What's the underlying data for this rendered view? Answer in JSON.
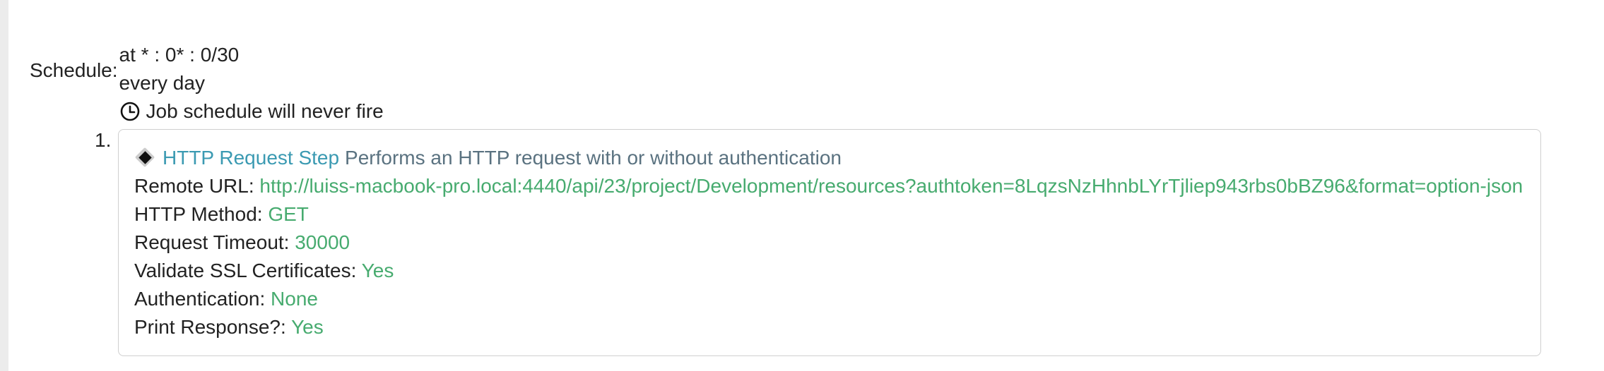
{
  "schedule": {
    "label": "Schedule:",
    "time": "at * : 0* : 0/30",
    "frequency": "every day",
    "status": "Job schedule will never fire"
  },
  "steps": [
    {
      "index": "1.",
      "title": "HTTP Request Step",
      "description": "Performs an HTTP request with or without authentication",
      "properties": [
        {
          "label": "Remote URL:",
          "value": "http://luiss-macbook-pro.local:4440/api/23/project/Development/resources?authtoken=8LqzsNzHhnbLYrTjliep943rbs0bBZ96&format=option-json"
        },
        {
          "label": "HTTP Method:",
          "value": "GET"
        },
        {
          "label": "Request Timeout:",
          "value": "30000"
        },
        {
          "label": "Validate SSL Certificates:",
          "value": "Yes"
        },
        {
          "label": "Authentication:",
          "value": "None"
        },
        {
          "label": "Print Response?:",
          "value": "Yes"
        }
      ]
    }
  ],
  "icons": {
    "status": "clock-icon",
    "step": "diamond-icon"
  },
  "colors": {
    "link": "#3b9ab2",
    "description": "#5a7280",
    "value": "#47ab6f",
    "text": "#222222"
  }
}
